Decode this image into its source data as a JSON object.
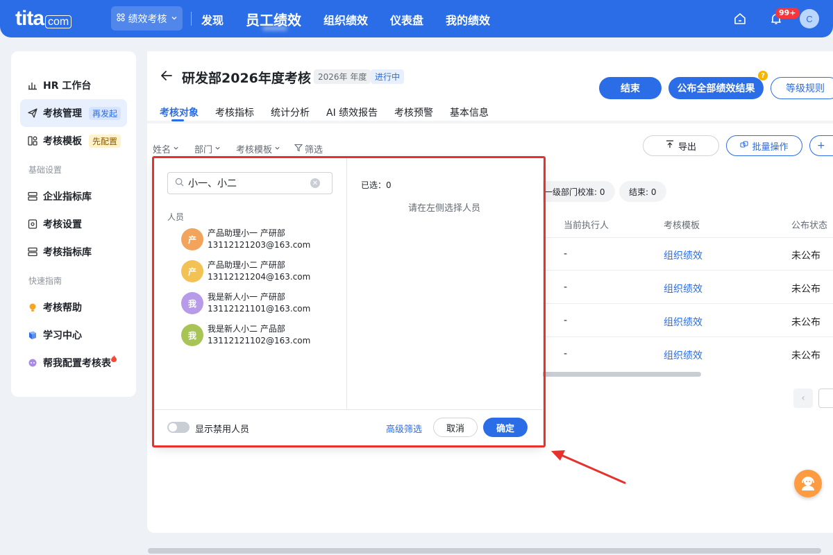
{
  "topbar": {
    "logo_text": "tita",
    "logo_suffix": "com",
    "app_switch_label": "绩效考核",
    "nav": [
      "发现",
      "员工绩效",
      "组织绩效",
      "仪表盘",
      "我的绩效"
    ],
    "active_nav": "员工绩效",
    "notification_badge": "99+",
    "avatar_initial": "C",
    "brand_color": "#2b6de6"
  },
  "sidebar": {
    "items": [
      {
        "label": "HR 工作台",
        "icon": "bar-chart-icon"
      },
      {
        "label": "考核管理",
        "tag": "再发起",
        "icon": "paper-plane-icon"
      },
      {
        "label": "考核模板",
        "tag": "先配置",
        "icon": "template-icon"
      }
    ],
    "section_basic": "基础设置",
    "basic_items": [
      {
        "label": "企业指标库",
        "icon": "database-icon"
      },
      {
        "label": "考核设置",
        "icon": "settings-doc-icon"
      },
      {
        "label": "考核指标库",
        "icon": "database-icon"
      }
    ],
    "section_guide": "快速指南",
    "guide_items": [
      {
        "label": "考核帮助",
        "icon": "lightbulb-icon"
      },
      {
        "label": "学习中心",
        "icon": "book-icon"
      },
      {
        "label": "帮我配置考核表",
        "icon": "assistant-icon"
      }
    ]
  },
  "header": {
    "title": "研发部2026年度考核",
    "period_tag": "2026年 年度",
    "status_tag": "进行中",
    "btn_end": "结束",
    "btn_publish": "公布全部绩效结果",
    "btn_rules": "等级规则",
    "help_badge": "?"
  },
  "tabs": [
    "考核对象",
    "考核指标",
    "统计分析",
    "AI 绩效报告",
    "考核预警",
    "基本信息"
  ],
  "filters": [
    "姓名",
    "部门",
    "考核模板",
    "筛选"
  ],
  "toolbar": {
    "export": "导出",
    "batch": "批量操作",
    "plus": "+"
  },
  "stats": [
    "一级部门校准: 0",
    "结束: 0"
  ],
  "table": {
    "headers": [
      "当前执行人",
      "考核模板",
      "公布状态"
    ],
    "rows": [
      {
        "executor": "-",
        "template": "组织绩效",
        "status": "未公布"
      },
      {
        "executor": "-",
        "template": "组织绩效",
        "status": "未公布"
      },
      {
        "executor": "-",
        "template": "组织绩效",
        "status": "未公布"
      },
      {
        "executor": "-",
        "template": "组织绩效",
        "status": "未公布"
      }
    ]
  },
  "pager": {
    "prev": "‹"
  },
  "popup": {
    "search_value": "小一、小二",
    "section_label": "人员",
    "people": [
      {
        "avatar": "产",
        "name": "产品助理小一 产研部",
        "email": "13112121203@163.com",
        "color": "#f3a45c"
      },
      {
        "avatar": "产",
        "name": "产品助理小二 产研部",
        "email": "13112121204@163.com",
        "color": "#f2c255"
      },
      {
        "avatar": "我",
        "name": "我是新人小一 产研部",
        "email": "13112121101@163.com",
        "color": "#b79ae8"
      },
      {
        "avatar": "我",
        "name": "我是新人小二 产品部",
        "email": "13112121102@163.com",
        "color": "#a7c454"
      }
    ],
    "selected_label": "已选：0",
    "empty_hint": "请在左侧选择人员",
    "toggle_label": "显示禁用人员",
    "advanced_filter": "高级筛选",
    "cancel": "取消",
    "confirm": "确定",
    "highlight_color": "#e5322d"
  }
}
